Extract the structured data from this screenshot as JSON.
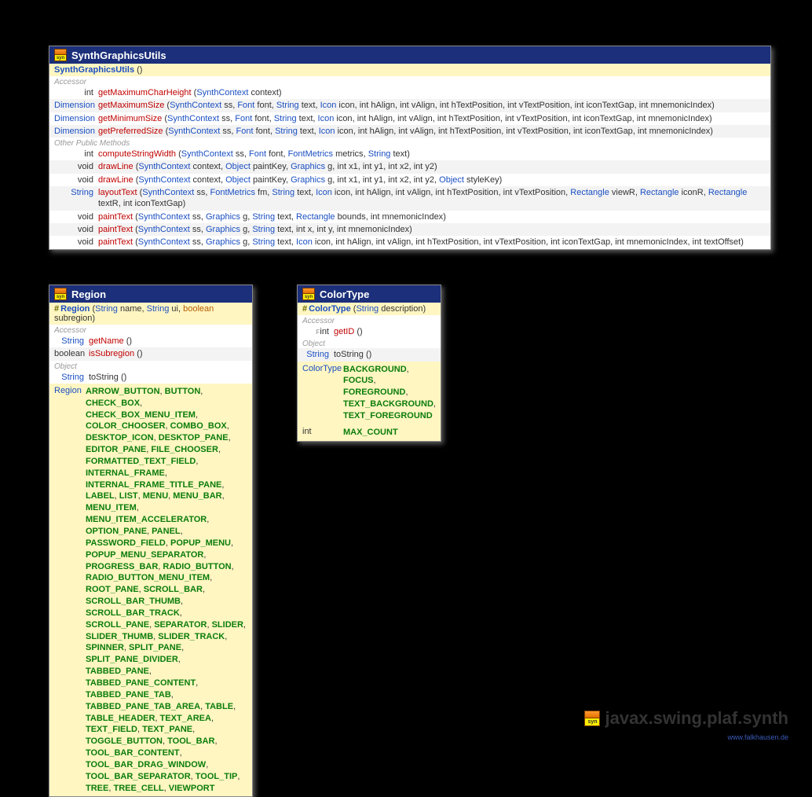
{
  "package": "javax.swing.plaf.synth",
  "credit": "www.falkhausen.de",
  "icon_label": "syn",
  "classes": {
    "sgu": {
      "name": "SynthGraphicsUtils",
      "constructor": {
        "name": "SynthGraphicsUtils",
        "params": "()"
      },
      "sections": [
        {
          "label": "Accessor",
          "methods": [
            {
              "ret": "int",
              "retClass": "prim",
              "name": "getMaximumCharHeight",
              "sig": [
                [
                  "SynthContext",
                  "context"
                ]
              ]
            },
            {
              "ret": "Dimension",
              "name": "getMaximumSize",
              "sig": [
                [
                  "SynthContext",
                  "ss"
                ],
                [
                  "Font",
                  "font"
                ],
                [
                  "String",
                  "text"
                ],
                [
                  "Icon",
                  "icon"
                ],
                [
                  "int",
                  "hAlign"
                ],
                [
                  "int",
                  "vAlign"
                ],
                [
                  "int",
                  "hTextPosition"
                ],
                [
                  "int",
                  "vTextPosition"
                ],
                [
                  "int",
                  "iconTextGap"
                ],
                [
                  "int",
                  "mnemonicIndex"
                ]
              ]
            },
            {
              "ret": "Dimension",
              "name": "getMinimumSize",
              "sig": [
                [
                  "SynthContext",
                  "ss"
                ],
                [
                  "Font",
                  "font"
                ],
                [
                  "String",
                  "text"
                ],
                [
                  "Icon",
                  "icon"
                ],
                [
                  "int",
                  "hAlign"
                ],
                [
                  "int",
                  "vAlign"
                ],
                [
                  "int",
                  "hTextPosition"
                ],
                [
                  "int",
                  "vTextPosition"
                ],
                [
                  "int",
                  "iconTextGap"
                ],
                [
                  "int",
                  "mnemonicIndex"
                ]
              ]
            },
            {
              "ret": "Dimension",
              "name": "getPreferredSize",
              "sig": [
                [
                  "SynthContext",
                  "ss"
                ],
                [
                  "Font",
                  "font"
                ],
                [
                  "String",
                  "text"
                ],
                [
                  "Icon",
                  "icon"
                ],
                [
                  "int",
                  "hAlign"
                ],
                [
                  "int",
                  "vAlign"
                ],
                [
                  "int",
                  "hTextPosition"
                ],
                [
                  "int",
                  "vTextPosition"
                ],
                [
                  "int",
                  "iconTextGap"
                ],
                [
                  "int",
                  "mnemonicIndex"
                ]
              ]
            }
          ]
        },
        {
          "label": "Other Public Methods",
          "methods": [
            {
              "ret": "int",
              "retClass": "prim",
              "name": "computeStringWidth",
              "sig": [
                [
                  "SynthContext",
                  "ss"
                ],
                [
                  "Font",
                  "font"
                ],
                [
                  "FontMetrics",
                  "metrics"
                ],
                [
                  "String",
                  "text"
                ]
              ]
            },
            {
              "ret": "void",
              "retClass": "void",
              "name": "drawLine",
              "sig": [
                [
                  "SynthContext",
                  "context"
                ],
                [
                  "Object",
                  "paintKey"
                ],
                [
                  "Graphics",
                  "g"
                ],
                [
                  "int",
                  "x1"
                ],
                [
                  "int",
                  "y1"
                ],
                [
                  "int",
                  "x2"
                ],
                [
                  "int",
                  "y2"
                ]
              ]
            },
            {
              "ret": "void",
              "retClass": "void",
              "name": "drawLine",
              "sig": [
                [
                  "SynthContext",
                  "context"
                ],
                [
                  "Object",
                  "paintKey"
                ],
                [
                  "Graphics",
                  "g"
                ],
                [
                  "int",
                  "x1"
                ],
                [
                  "int",
                  "y1"
                ],
                [
                  "int",
                  "x2"
                ],
                [
                  "int",
                  "y2"
                ],
                [
                  "Object",
                  "styleKey"
                ]
              ]
            },
            {
              "ret": "String",
              "name": "layoutText",
              "sig": [
                [
                  "SynthContext",
                  "ss"
                ],
                [
                  "FontMetrics",
                  "fm"
                ],
                [
                  "String",
                  "text"
                ],
                [
                  "Icon",
                  "icon"
                ],
                [
                  "int",
                  "hAlign"
                ],
                [
                  "int",
                  "vAlign"
                ],
                [
                  "int",
                  "hTextPosition"
                ],
                [
                  "int",
                  "vTextPosition"
                ],
                [
                  "Rectangle",
                  "viewR"
                ],
                [
                  "Rectangle",
                  "iconR"
                ],
                [
                  "Rectangle",
                  "textR"
                ],
                [
                  "int",
                  "iconTextGap"
                ]
              ]
            },
            {
              "ret": "void",
              "retClass": "void",
              "name": "paintText",
              "sig": [
                [
                  "SynthContext",
                  "ss"
                ],
                [
                  "Graphics",
                  "g"
                ],
                [
                  "String",
                  "text"
                ],
                [
                  "Rectangle",
                  "bounds"
                ],
                [
                  "int",
                  "mnemonicIndex"
                ]
              ]
            },
            {
              "ret": "void",
              "retClass": "void",
              "name": "paintText",
              "sig": [
                [
                  "SynthContext",
                  "ss"
                ],
                [
                  "Graphics",
                  "g"
                ],
                [
                  "String",
                  "text"
                ],
                [
                  "int",
                  "x"
                ],
                [
                  "int",
                  "y"
                ],
                [
                  "int",
                  "mnemonicIndex"
                ]
              ]
            },
            {
              "ret": "void",
              "retClass": "void",
              "name": "paintText",
              "sig": [
                [
                  "SynthContext",
                  "ss"
                ],
                [
                  "Graphics",
                  "g"
                ],
                [
                  "String",
                  "text"
                ],
                [
                  "Icon",
                  "icon"
                ],
                [
                  "int",
                  "hAlign"
                ],
                [
                  "int",
                  "vAlign"
                ],
                [
                  "int",
                  "hTextPosition"
                ],
                [
                  "int",
                  "vTextPosition"
                ],
                [
                  "int",
                  "iconTextGap"
                ],
                [
                  "int",
                  "mnemonicIndex"
                ],
                [
                  "int",
                  "textOffset"
                ]
              ]
            }
          ]
        }
      ]
    },
    "region": {
      "name": "Region",
      "constructor": {
        "protected": true,
        "name": "Region",
        "params_sig": [
          [
            "String",
            "name"
          ],
          [
            "String",
            "ui"
          ],
          [
            "boolean",
            "subregion"
          ]
        ]
      },
      "sections": [
        {
          "label": "Accessor",
          "methods": [
            {
              "ret": "String",
              "name": "getName",
              "sig": []
            },
            {
              "ret": "boolean",
              "retClass": "prim",
              "name": "isSubregion",
              "sig": []
            }
          ]
        },
        {
          "label": "Object",
          "methods": [
            {
              "ret": "String",
              "name": "toString",
              "plain": true,
              "sig": []
            }
          ]
        }
      ],
      "constants": {
        "type": "Region",
        "items": [
          "ARROW_BUTTON",
          "BUTTON",
          "CHECK_BOX",
          "CHECK_BOX_MENU_ITEM",
          "COLOR_CHOOSER",
          "COMBO_BOX",
          "DESKTOP_ICON",
          "DESKTOP_PANE",
          "EDITOR_PANE",
          "FILE_CHOOSER",
          "FORMATTED_TEXT_FIELD",
          "INTERNAL_FRAME",
          "INTERNAL_FRAME_TITLE_PANE",
          "LABEL",
          "LIST",
          "MENU",
          "MENU_BAR",
          "MENU_ITEM",
          "MENU_ITEM_ACCELERATOR",
          "OPTION_PANE",
          "PANEL",
          "PASSWORD_FIELD",
          "POPUP_MENU",
          "POPUP_MENU_SEPARATOR",
          "PROGRESS_BAR",
          "RADIO_BUTTON",
          "RADIO_BUTTON_MENU_ITEM",
          "ROOT_PANE",
          "SCROLL_BAR",
          "SCROLL_BAR_THUMB",
          "SCROLL_BAR_TRACK",
          "SCROLL_PANE",
          "SEPARATOR",
          "SLIDER",
          "SLIDER_THUMB",
          "SLIDER_TRACK",
          "SPINNER",
          "SPLIT_PANE",
          "SPLIT_PANE_DIVIDER",
          "TABBED_PANE",
          "TABBED_PANE_CONTENT",
          "TABBED_PANE_TAB",
          "TABBED_PANE_TAB_AREA",
          "TABLE",
          "TABLE_HEADER",
          "TEXT_AREA",
          "TEXT_FIELD",
          "TEXT_PANE",
          "TOGGLE_BUTTON",
          "TOOL_BAR",
          "TOOL_BAR_CONTENT",
          "TOOL_BAR_DRAG_WINDOW",
          "TOOL_BAR_SEPARATOR",
          "TOOL_TIP",
          "TREE",
          "TREE_CELL",
          "VIEWPORT"
        ]
      }
    },
    "colortype": {
      "name": "ColorType",
      "constructor": {
        "protected": true,
        "name": "ColorType",
        "params_sig": [
          [
            "String",
            "description"
          ]
        ]
      },
      "sections": [
        {
          "label": "Accessor",
          "methods": [
            {
              "ret": "int",
              "retClass": "prim",
              "final": true,
              "name": "getID",
              "sig": []
            }
          ]
        },
        {
          "label": "Object",
          "methods": [
            {
              "ret": "String",
              "name": "toString",
              "plain": true,
              "sig": []
            }
          ]
        }
      ],
      "constants_list": [
        {
          "type": "ColorType",
          "items": [
            "BACKGROUND",
            "FOCUS",
            "FOREGROUND",
            "TEXT_BACKGROUND",
            "TEXT_FOREGROUND"
          ]
        },
        {
          "type": "int",
          "items": [
            "MAX_COUNT"
          ]
        }
      ]
    }
  }
}
